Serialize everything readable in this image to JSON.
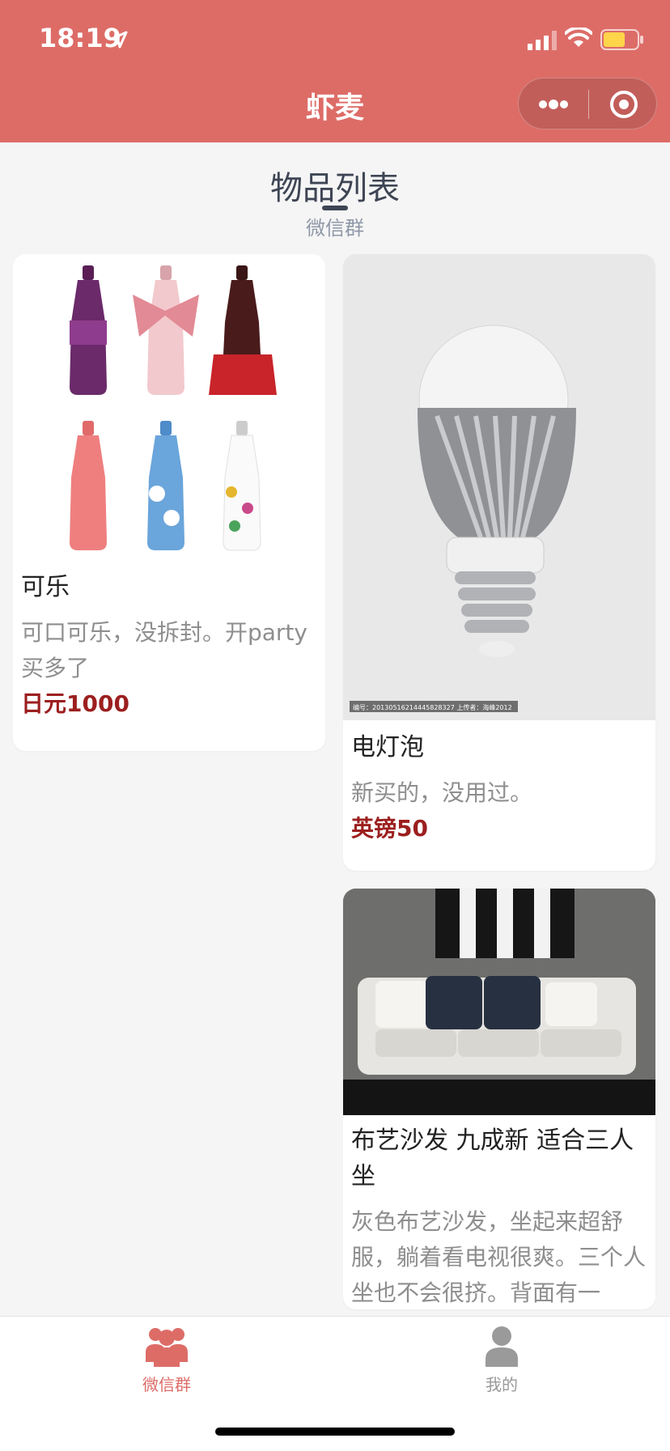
{
  "status": {
    "time": "18:19"
  },
  "nav": {
    "title": "虾麦"
  },
  "section": {
    "title": "物品列表",
    "subtitle": "微信群"
  },
  "items": [
    {
      "name": "可乐",
      "description": "可口可乐，没拆封。开party买多了",
      "price": "日元1000",
      "image": "coca-cola-bottles"
    },
    {
      "name": "电灯泡",
      "description": "新买的，没用过。",
      "price": "英镑50",
      "image": "light-bulb",
      "image_caption": "编号：20130516214445828327 上传者：海峰2012"
    },
    {
      "name": "布艺沙发 九成新 适合三人坐",
      "description": "灰色布艺沙发，坐起来超舒服，躺着看电视很爽。三个人坐也不会很挤。背面有一",
      "price": "",
      "image": "sofa"
    }
  ],
  "tabbar": {
    "tabs": [
      {
        "label": "微信群",
        "icon": "group-icon",
        "active": true
      },
      {
        "label": "我的",
        "icon": "user-icon",
        "active": false
      }
    ]
  },
  "colors": {
    "brand": "#dd6c67",
    "price": "#9c1f1f",
    "tab_active": "#dd6c67",
    "tab_inactive": "#999999"
  }
}
